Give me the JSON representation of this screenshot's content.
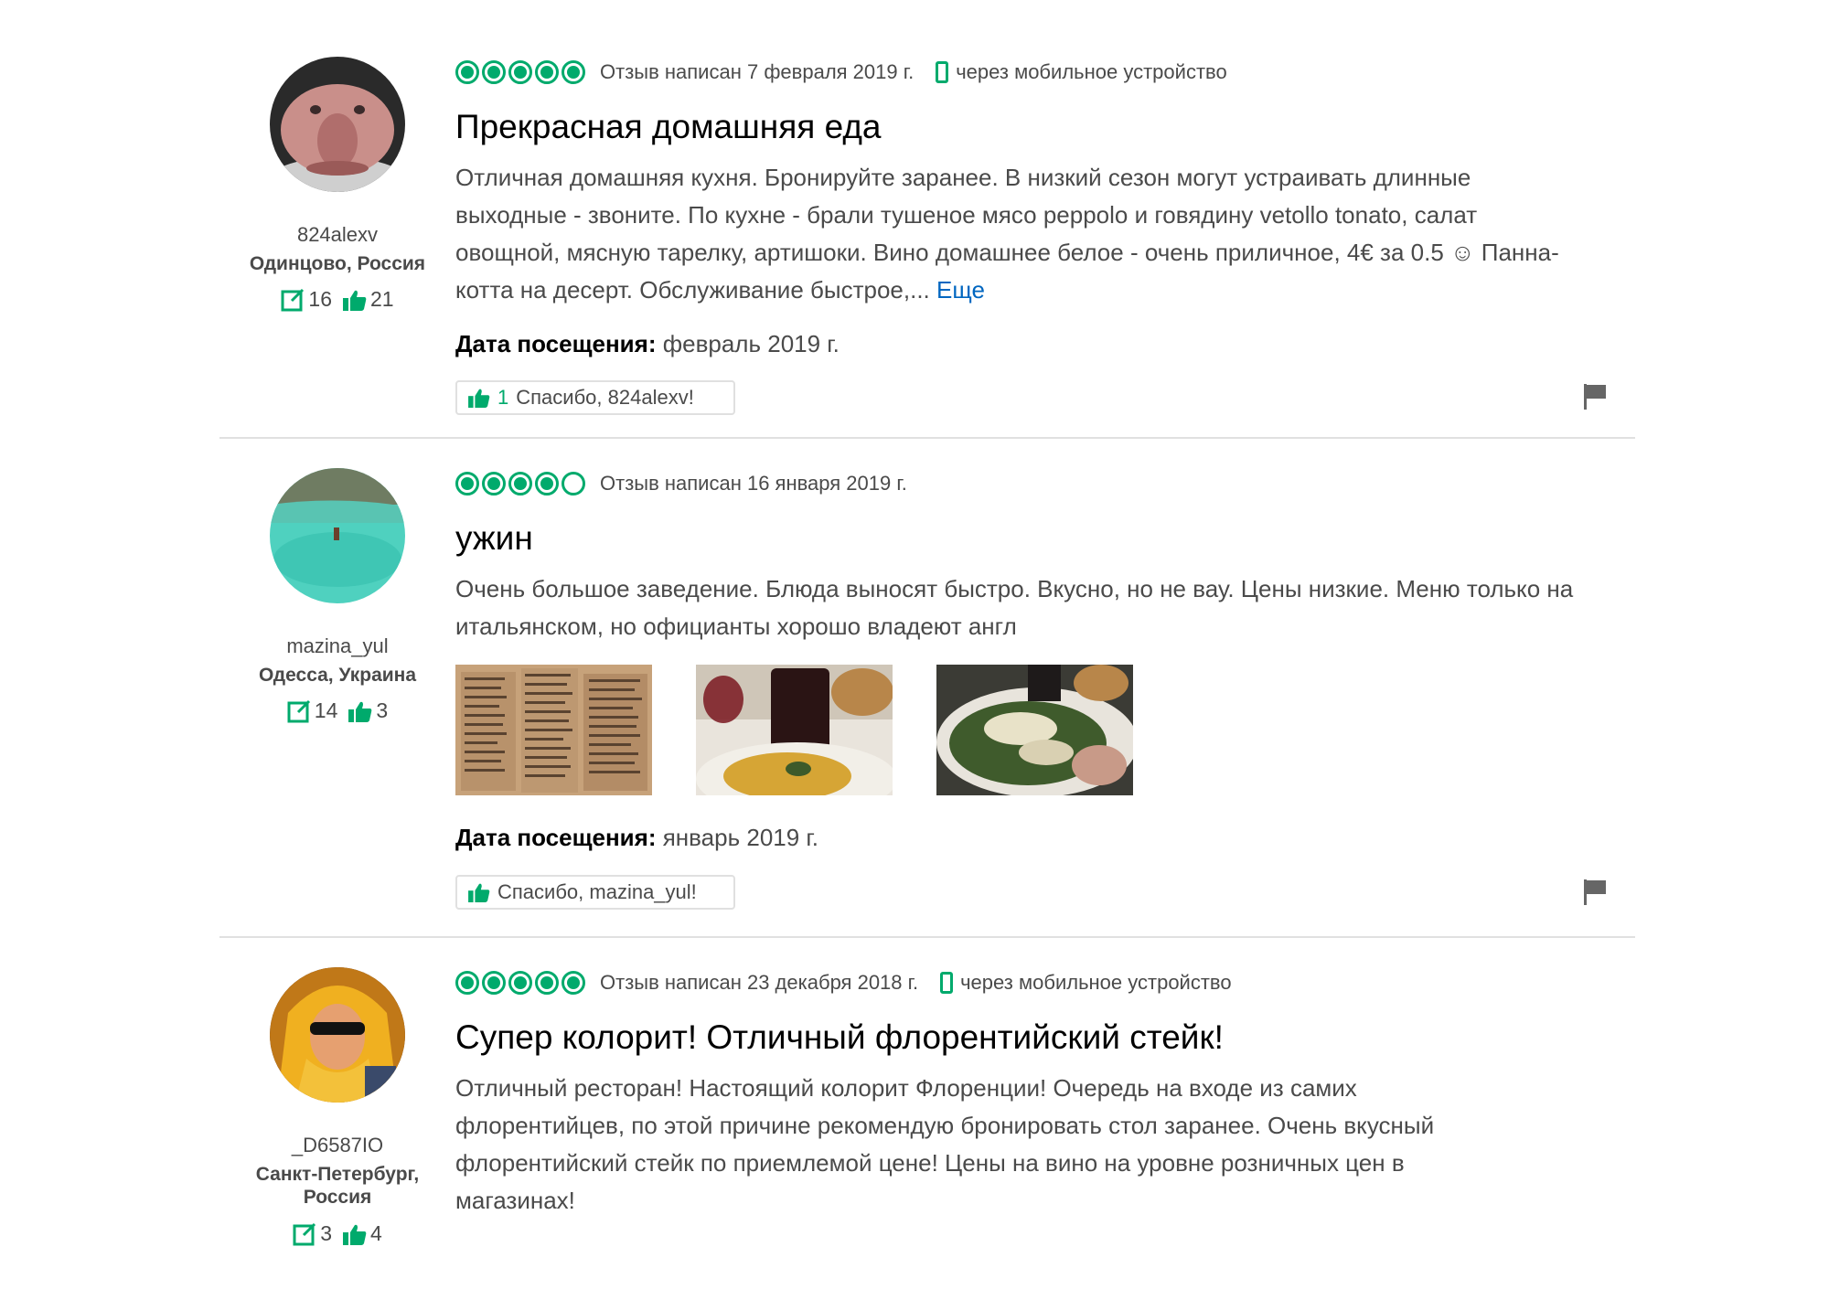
{
  "colors": {
    "accent": "#00aa6c",
    "link": "#0066c0",
    "text": "#4a4a4a"
  },
  "reviews": [
    {
      "username": "824alexv",
      "location": "Одинцово, Россия",
      "reviews_count": "16",
      "likes_count": "21",
      "rating": 5,
      "date": "Отзыв написан 7 февраля 2019 г.",
      "mobile": "через мобильное устройство",
      "title": "Прекрасная домашняя еда",
      "body": "Отличная домашняя кухня. Бронируйте заранее. В низкий сезон могут устраивать длинные выходные - звоните. По кухне - брали тушеное мясо peppolo и говядину vetollo tonato, салат овощной, мясную тарелку, артишоки. Вино домашнее белое - очень приличное, 4€ за 0.5 ☺ Панна-котта на десерт. Обслуживание быстрое,...",
      "more": "Еще",
      "visit_label": "Дата посещения:",
      "visit_value": "февраль 2019 г.",
      "thanks_count": "1",
      "thanks_label": "Спасибо, 824alexv!"
    },
    {
      "username": "mazina_yul",
      "location": "Одесса, Украина",
      "reviews_count": "14",
      "likes_count": "3",
      "rating": 4,
      "date": "Отзыв написан 16 января 2019 г.",
      "title": "ужин",
      "body": "Очень большое заведение. Блюда выносят быстро. Вкусно, но не вау. Цены низкие. Меню только на итальянском, но официанты хорошо владеют англ",
      "photos": [
        "menu-photo",
        "wine-and-pasta-photo",
        "salad-photo"
      ],
      "visit_label": "Дата посещения:",
      "visit_value": "январь 2019 г.",
      "thanks_label": "Спасибо, mazina_yul!"
    },
    {
      "username": "_D6587IO",
      "location": "Санкт-Петербург, Россия",
      "reviews_count": "3",
      "likes_count": "4",
      "rating": 5,
      "date": "Отзыв написан 23 декабря 2018 г.",
      "mobile": "через мобильное устройство",
      "title": "Супер колорит! Отличный флорентийский стейк!",
      "body": "Отличный ресторан! Настоящий колорит Флоренции! Очередь на входе из самих флорентийцев, по этой причине рекомендую бронировать стол заранее. Очень вкусный флорентийский стейк по приемлемой цене! Цены на вино на уровне розничных цен в магазинах!"
    }
  ]
}
